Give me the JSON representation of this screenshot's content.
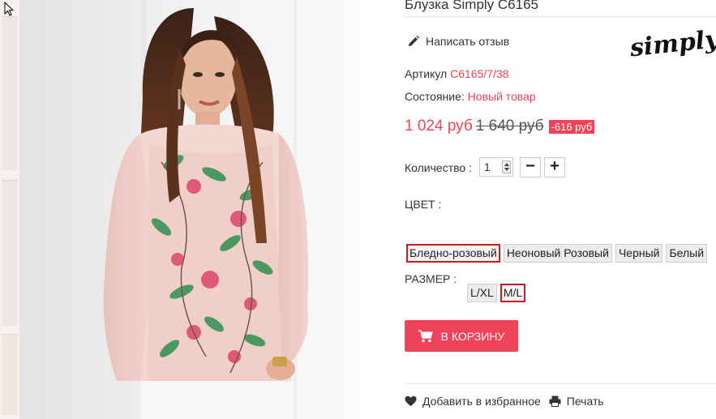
{
  "product": {
    "title": "Блузка Simply C6165",
    "review_label": "Написать отзыв",
    "brand_logo_text": "simply",
    "sku_label": "Артикул",
    "sku_value": "C6165/7/38",
    "condition_label": "Состояние:",
    "condition_value": "Новый товар",
    "price_new": "1 024 руб",
    "price_old": "1 640 руб",
    "discount": "-616 руб"
  },
  "quantity": {
    "label": "Количество :",
    "value": "1",
    "minus": "−",
    "plus": "+"
  },
  "color": {
    "label": "ЦВЕТ :",
    "options": [
      "Бледно-розовый",
      "Неоновый Розовый",
      "Черный",
      "Белый"
    ],
    "selected": "Бледно-розовый"
  },
  "size": {
    "label": "РАЗМЕР :",
    "options": [
      "L/XL",
      "M/L"
    ],
    "selected": "M/L"
  },
  "actions": {
    "add_to_cart": "В КОРЗИНУ",
    "wishlist": "Добавить в избранное",
    "print": "Печать"
  },
  "colors": {
    "accent": "#f0435a",
    "selected_border": "#d11a1a"
  },
  "icons": [
    "pencil-icon",
    "cart-icon",
    "heart-icon",
    "printer-icon"
  ]
}
